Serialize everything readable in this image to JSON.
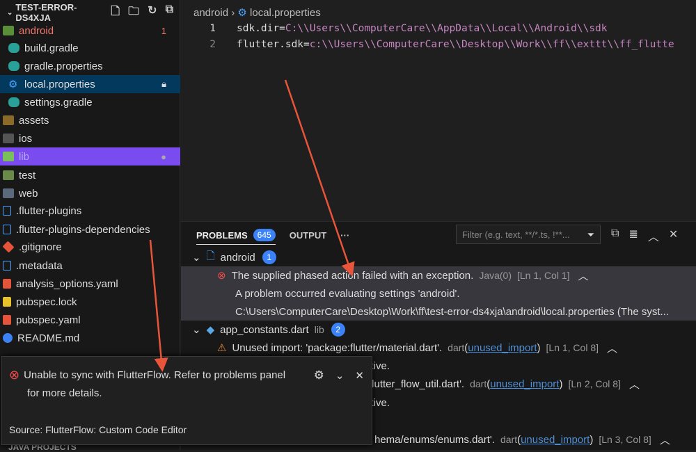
{
  "explorer": {
    "title": "TEST-ERROR-DS4XJA",
    "items": [
      {
        "label": "android",
        "badge": "1"
      },
      {
        "label": "build.gradle"
      },
      {
        "label": "gradle.properties"
      },
      {
        "label": "local.properties"
      },
      {
        "label": "settings.gradle"
      },
      {
        "label": "assets"
      },
      {
        "label": "ios"
      },
      {
        "label": "lib"
      },
      {
        "label": "test"
      },
      {
        "label": "web"
      },
      {
        "label": ".flutter-plugins"
      },
      {
        "label": ".flutter-plugins-dependencies"
      },
      {
        "label": ".gitignore"
      },
      {
        "label": ".metadata"
      },
      {
        "label": "analysis_options.yaml"
      },
      {
        "label": "pubspec.lock"
      },
      {
        "label": "pubspec.yaml"
      },
      {
        "label": "README.md"
      }
    ],
    "java_projects": "JAVA PROJECTS"
  },
  "editor": {
    "breadcrumb": [
      "android",
      "local.properties"
    ],
    "lines": [
      {
        "num": "1",
        "key": "sdk.dir=",
        "value": "C:\\\\Users\\\\ComputerCare\\\\AppData\\\\Local\\\\Android\\\\sdk"
      },
      {
        "num": "2",
        "key": "flutter.sdk=",
        "value": "c:\\\\Users\\\\ComputerCare\\\\Desktop\\\\Work\\\\ff\\\\exttt\\\\ff_flutte"
      }
    ]
  },
  "panel": {
    "tab_problems": "PROBLEMS",
    "problems_count": "645",
    "tab_output": "OUTPUT",
    "more": "···",
    "filter_placeholder": "Filter (e.g. text, **/*.ts, !**...",
    "groups": [
      {
        "file": "android",
        "count": "1",
        "msg": "The supplied phased action failed with an exception.",
        "source": "Java(0)",
        "loc": "[Ln 1, Col 1]",
        "detail1": "A problem occurred evaluating settings 'android'.",
        "detail2": "C:\\Users\\ComputerCare\\Desktop\\Work\\ff\\test-error-ds4xja\\android\\local.properties (The syst..."
      },
      {
        "file": "app_constants.dart",
        "folder": "lib",
        "count": "2",
        "items": [
          {
            "msg": "Unused import: 'package:flutter/material.dart'.",
            "src": "dart",
            "code": "unused_import",
            "loc": "[Ln 1, Col 8]",
            "tail": "ctive."
          },
          {
            "msg": "flutter_flow_util.dart'.",
            "src": "dart",
            "code": "unused_import",
            "loc": "[Ln 2, Col 8]",
            "tail": "ctive."
          },
          {
            "msg": "hema/enums/enums.dart'.",
            "src": "dart",
            "code": "unused_import",
            "loc": "[Ln 3, Col 8]"
          }
        ]
      }
    ]
  },
  "notification": {
    "message": "Unable to sync with FlutterFlow. Refer to problems panel",
    "message2": "for more details.",
    "source": "Source: FlutterFlow: Custom Code Editor"
  },
  "colors": {
    "accent": "#3b82f6",
    "selected": "#04395e",
    "highlight": "#7a4cf0",
    "error": "#f14c4c",
    "warning": "#cca700",
    "annotation": "#e8553a"
  }
}
